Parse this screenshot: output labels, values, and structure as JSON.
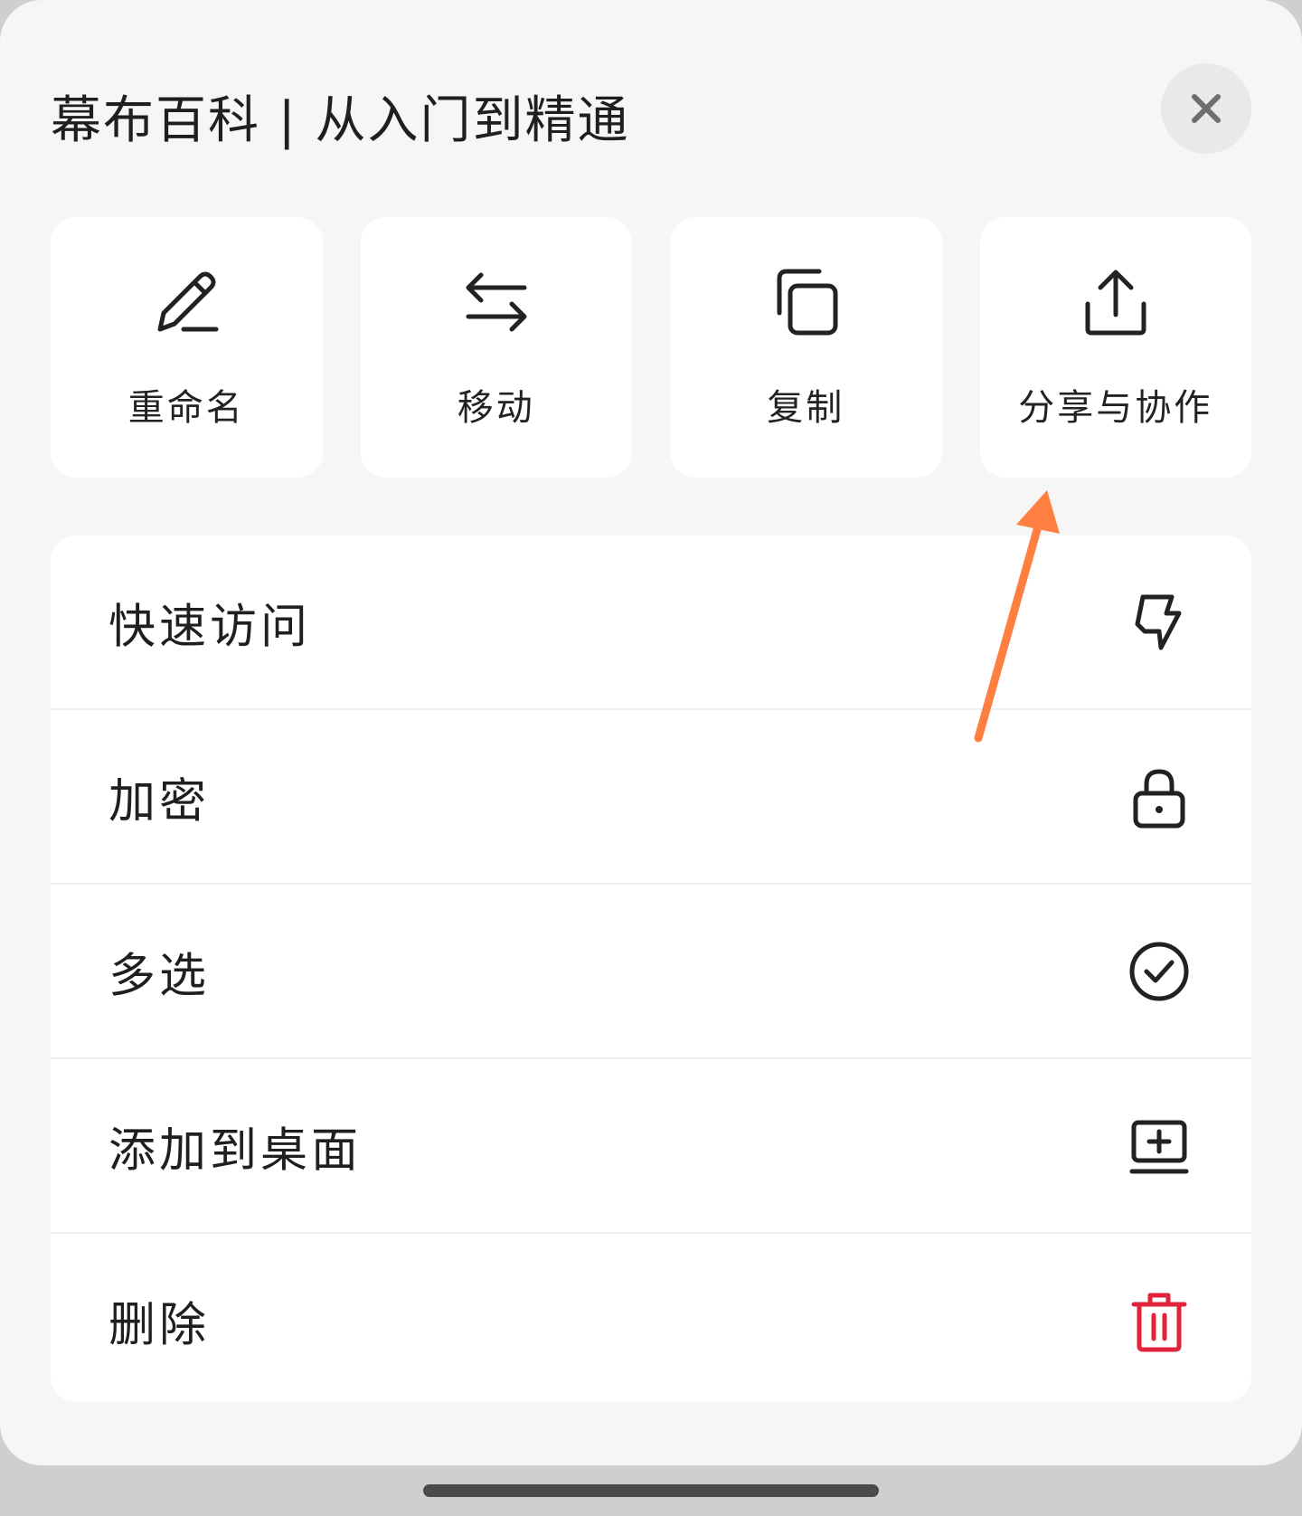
{
  "header": {
    "title": "幕布百科 | 从入门到精通"
  },
  "actions": [
    {
      "label": "重命名",
      "icon": "pencil-icon"
    },
    {
      "label": "移动",
      "icon": "swap-arrows-icon"
    },
    {
      "label": "复制",
      "icon": "copy-icon"
    },
    {
      "label": "分享与协作",
      "icon": "share-icon"
    }
  ],
  "list": [
    {
      "label": "快速访问",
      "icon": "lightning-icon"
    },
    {
      "label": "加密",
      "icon": "lock-icon"
    },
    {
      "label": "多选",
      "icon": "check-circle-icon"
    },
    {
      "label": "添加到桌面",
      "icon": "add-to-desktop-icon"
    },
    {
      "label": "删除",
      "icon": "trash-icon"
    }
  ],
  "colors": {
    "sheet_bg": "#f6f6f6",
    "card_bg": "#ffffff",
    "text": "#1f1f1f",
    "delete_red": "#e0243c",
    "annotation_arrow": "#ff7f41"
  }
}
